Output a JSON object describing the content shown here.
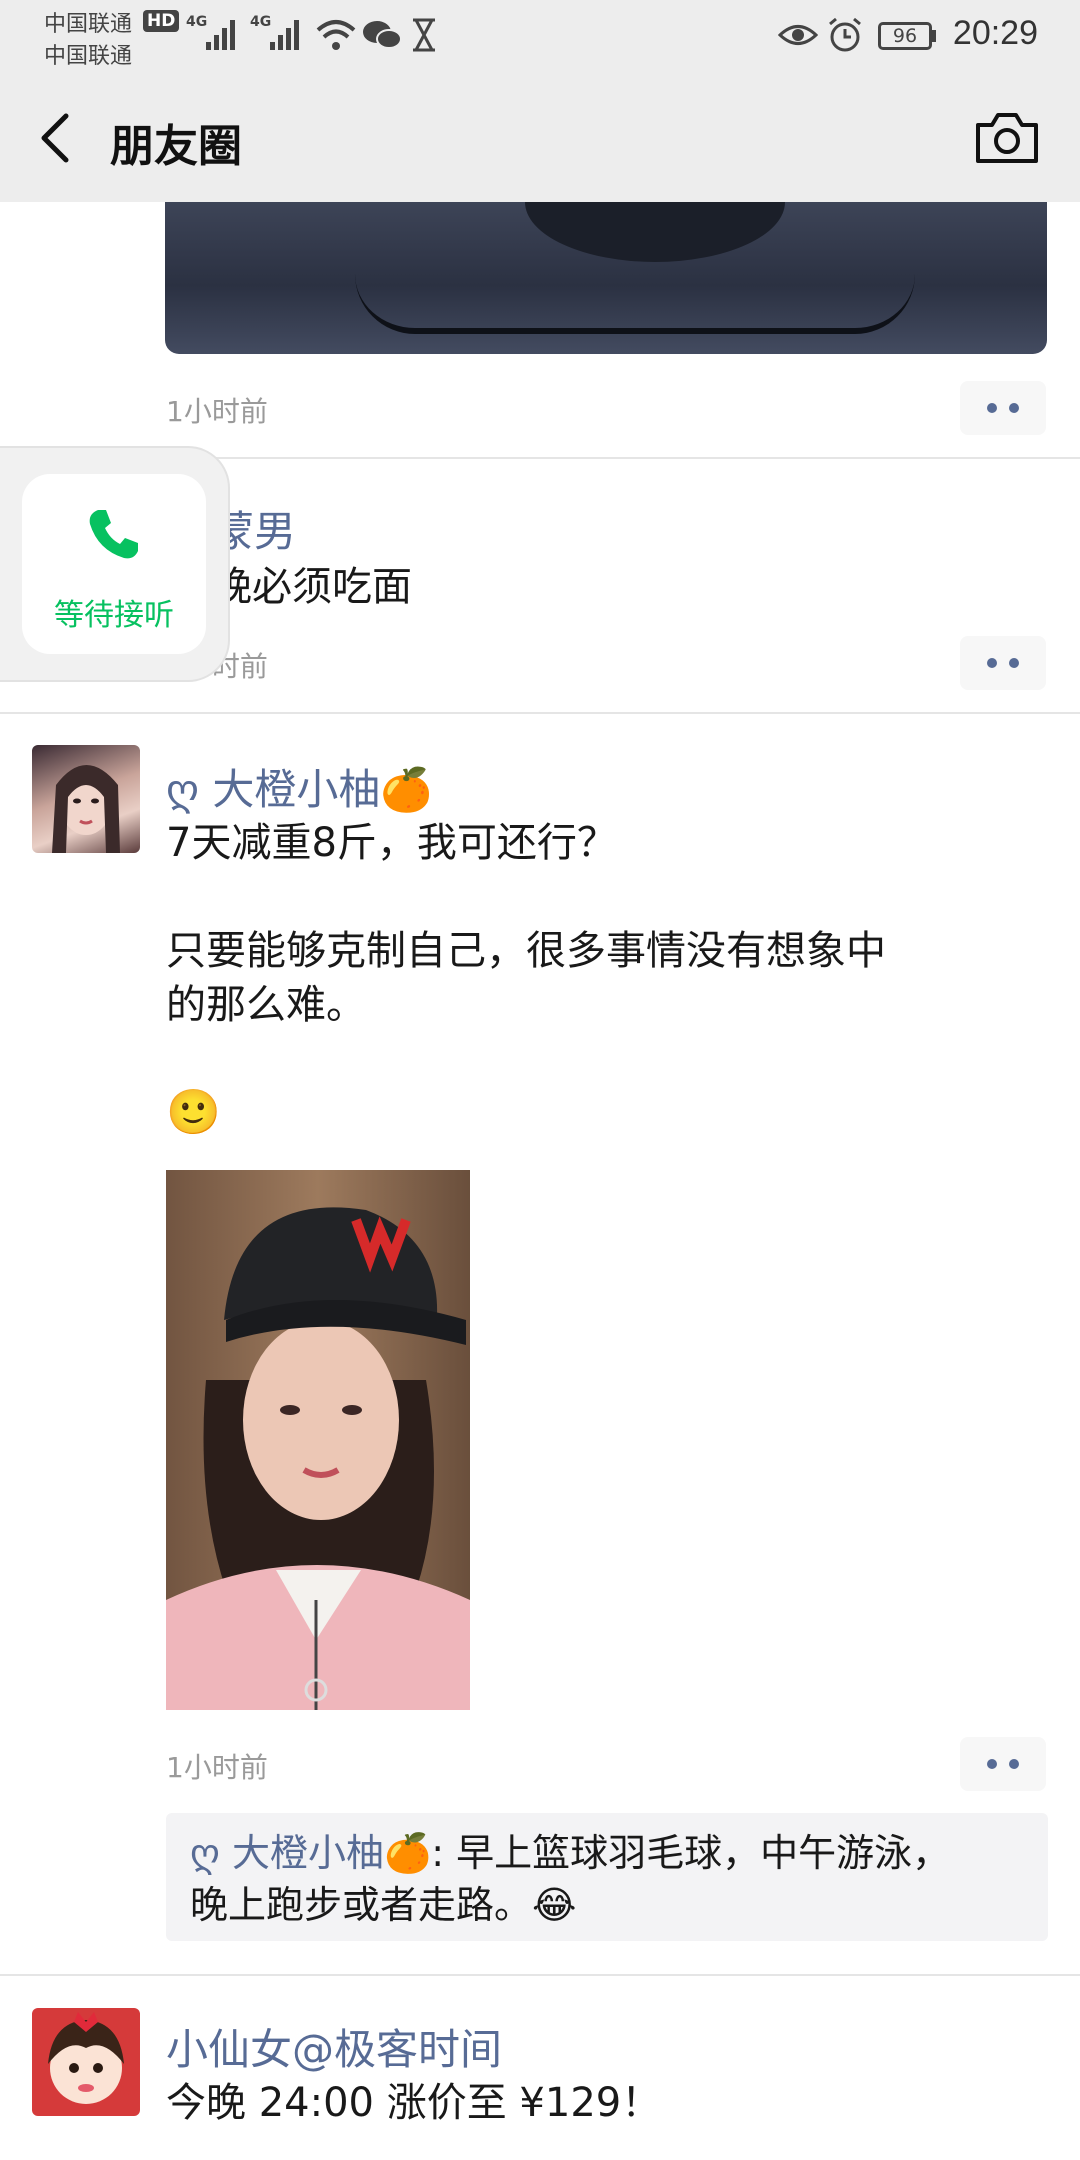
{
  "status_bar": {
    "carrier_1": "中国联通",
    "carrier_2": "中国联通",
    "hd": "HD",
    "network_1": "4G",
    "network_2": "4G",
    "battery": "96",
    "time": "20:29"
  },
  "header": {
    "title": "朋友圈"
  },
  "feed": {
    "post1": {
      "time": "1小时前"
    },
    "post2": {
      "name": "蒙男",
      "text": "晚必须吃面",
      "time": "1小时前"
    },
    "post3": {
      "name": "ღ 大橙小柚🍊",
      "line1": "7天减重8斤，我可还行？",
      "line2": "只要能够克制自己，很多事情没有想象中",
      "line3": "的那么难。",
      "emoji": "🙂",
      "time": "1小时前",
      "comment": {
        "author": "ღ 大橙小柚🍊",
        "sep": ": ",
        "line1": "早上篮球羽毛球，中午游泳，",
        "line2": "晚上跑步或者走路。😂"
      }
    },
    "post4": {
      "name": "小仙女@极客时间",
      "text": "今晚 24:00 涨价至 ¥129！"
    }
  },
  "call_widget": {
    "label": "等待接听"
  },
  "colors": {
    "name": "#576b95",
    "accent_green": "#07c160",
    "header_bg": "#ededed"
  }
}
